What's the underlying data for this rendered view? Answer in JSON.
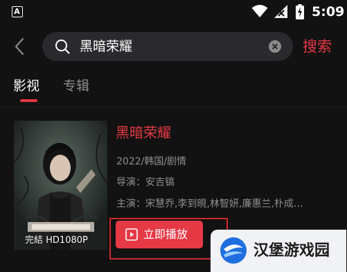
{
  "status_bar": {
    "app_indicator": "A",
    "time": "5:09",
    "icons": [
      "app-indicator-icon",
      "wifi-icon",
      "signal-off-icon",
      "battery-charging-icon"
    ]
  },
  "header": {
    "search_value": "黑暗荣耀",
    "search_button": "搜索",
    "icons": [
      "back-icon",
      "search-icon",
      "clear-icon"
    ]
  },
  "tabs": [
    {
      "label": "影视",
      "active": true
    },
    {
      "label": "专辑",
      "active": false
    }
  ],
  "result": {
    "title": "黑暗荣耀",
    "meta": "2022/韩国/剧情",
    "director": "导演：安吉镐",
    "cast": "主演：宋慧乔,李到晛,林智妍,廉惠兰,朴成…",
    "poster_status": "完結 HD1080P",
    "play_button": "立即播放"
  },
  "watermark": {
    "text": "汉堡游戏园"
  },
  "colors": {
    "background": "#121212",
    "accent": "#e63946",
    "search_bg": "#2a2a2e",
    "muted_text": "#8f8f8f"
  }
}
